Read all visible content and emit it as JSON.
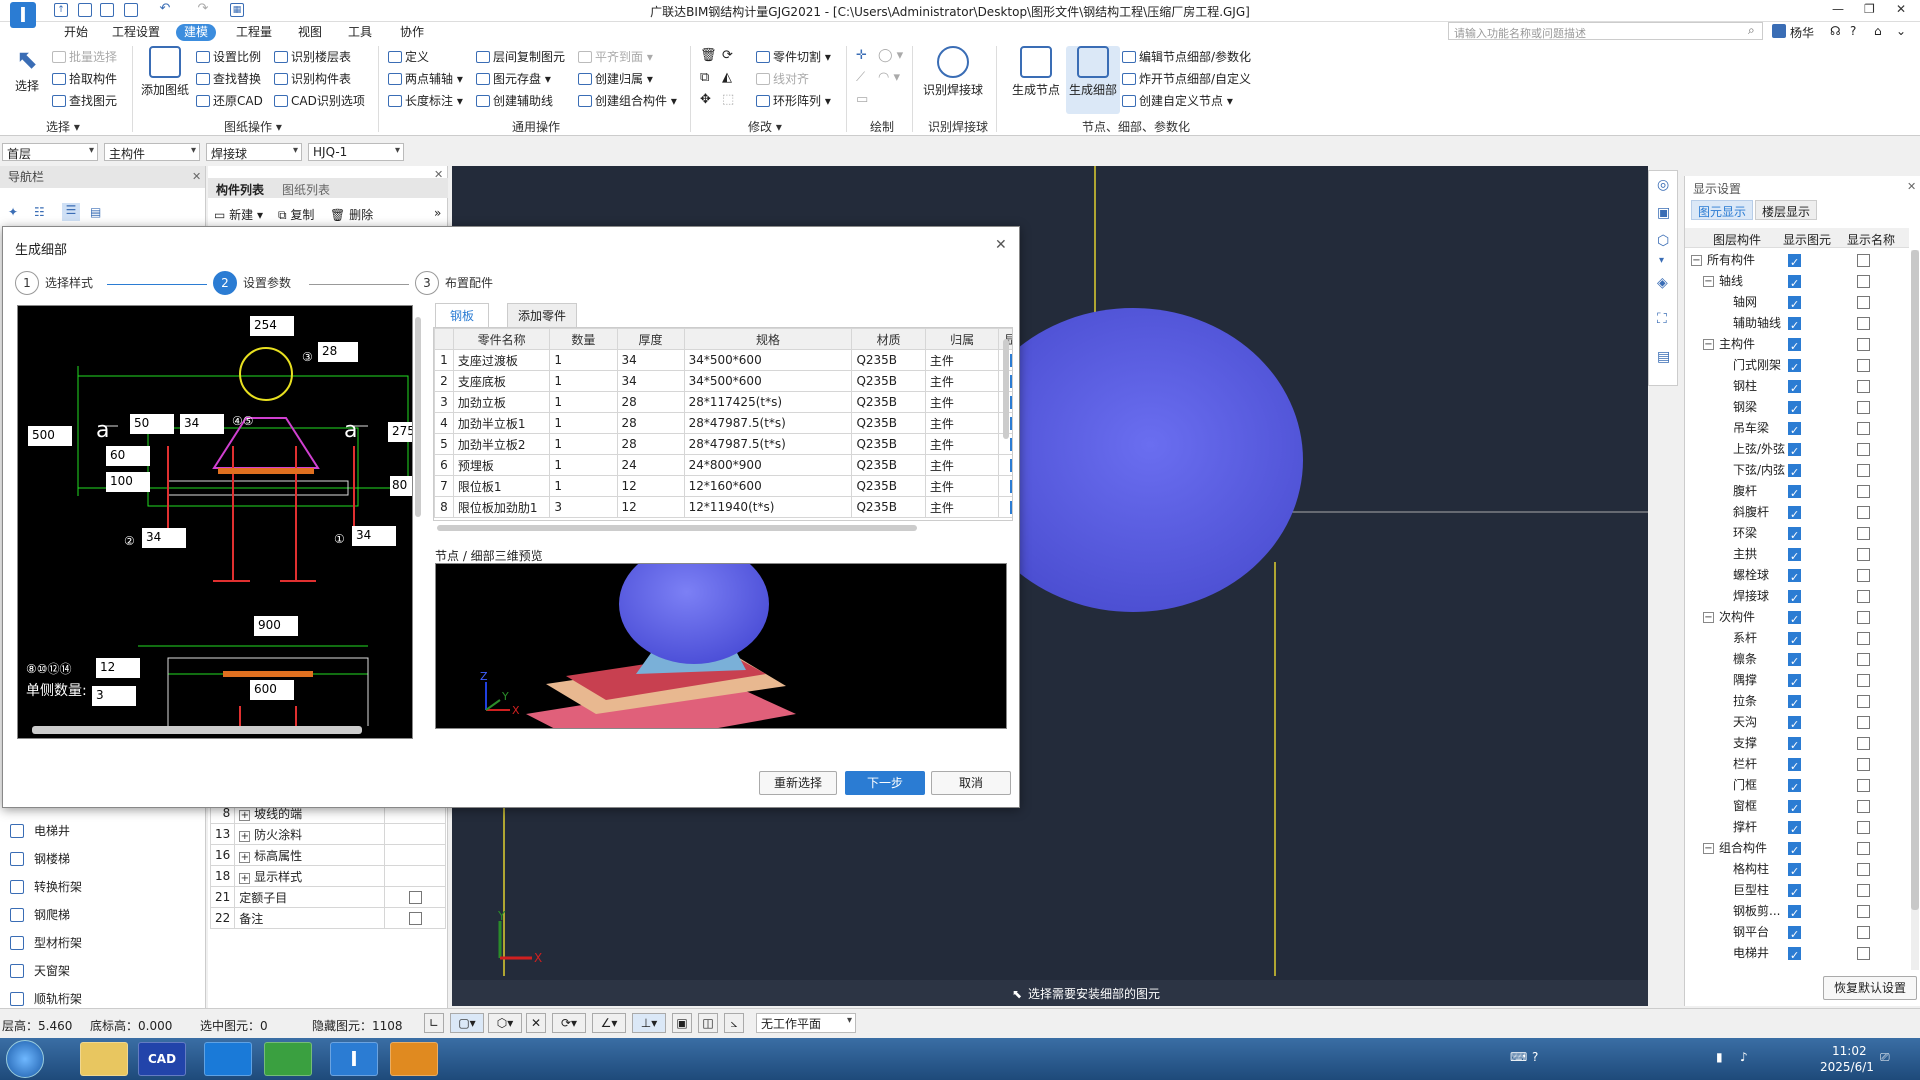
{
  "titlebar": {
    "title": "广联达BIM钢结构计量GJG2021 - [C:\\Users\\Administrator\\Desktop\\图形文件\\钢结构工程\\压缩厂房工程.GJG]",
    "search_placeholder": "请输入功能名称或问题描述",
    "user": "杨华",
    "help": "?"
  },
  "menu": [
    "开始",
    "工程设置",
    "建模",
    "工程量",
    "视图",
    "工具",
    "协作"
  ],
  "ribbon": {
    "select": {
      "label": "选择",
      "items": [
        "批量选择",
        "拾取构件",
        "查找图元"
      ],
      "group": "选择"
    },
    "drawing": {
      "add": "添加图纸",
      "items": [
        "设置比例",
        "查找替换",
        "还原CAD",
        "识别楼层表",
        "识别构件表",
        "CAD识别选项"
      ],
      "group": "图纸操作"
    },
    "general": {
      "items": [
        "定义",
        "两点辅轴",
        "长度标注",
        "层间复制图元",
        "图元存盘",
        "创建辅助线",
        "平齐到面",
        "创建归属",
        "创建组合构件"
      ],
      "group": "通用操作"
    },
    "modify": {
      "items": [
        "零件切割",
        "线对齐",
        "环形阵列"
      ],
      "group": "修改"
    },
    "draw": {
      "group": "绘制"
    },
    "weld": {
      "label": "识别焊接球",
      "group": "识别焊接球"
    },
    "node": {
      "gen_node": "生成节点",
      "gen_detail": "生成细部",
      "items": [
        "编辑节点细部/参数化",
        "炸开节点细部/自定义",
        "创建自定义节点"
      ],
      "group": "节点、细部、参数化"
    }
  },
  "filters": [
    "首层",
    "主构件",
    "焊接球",
    "HJQ-1"
  ],
  "nav": {
    "title": "导航栏",
    "items": [
      "电梯井",
      "钢楼梯",
      "转换桁架",
      "钢爬梯",
      "型材桁架",
      "天窗架",
      "顺轨桁架"
    ]
  },
  "components": {
    "tabs": [
      "构件列表",
      "图纸列表"
    ],
    "actions": [
      "新建",
      "复制",
      "删除"
    ],
    "props": [
      {
        "no": "8",
        "name": "坡线的端"
      },
      {
        "no": "13",
        "name": "防火涂料"
      },
      {
        "no": "16",
        "name": "标高属性"
      },
      {
        "no": "18",
        "name": "显示样式"
      },
      {
        "no": "21",
        "name": "定额子目"
      },
      {
        "no": "22",
        "name": "备注"
      }
    ]
  },
  "dialog": {
    "title": "生成细部",
    "steps": [
      {
        "no": "1",
        "label": "选择样式"
      },
      {
        "no": "2",
        "label": "设置参数"
      },
      {
        "no": "3",
        "label": "布置配件"
      }
    ],
    "cad_labels": {
      "d254": "254",
      "d28": "28",
      "d500": "500",
      "d50": "50",
      "d34a": "34",
      "d60": "60",
      "d100": "100",
      "d275": "275",
      "d80": "80",
      "d34b": "34",
      "d34c": "34",
      "d900": "900",
      "d12": "12",
      "d3": "3",
      "d600": "600",
      "a1": "a",
      "a2": "a",
      "c3": "③",
      "c45": "④⑤",
      "c2": "②",
      "c1": "①",
      "circles": "⑧⑩⑫⑭",
      "side_qty": "单侧数量:"
    },
    "tabs": [
      "钢板",
      "添加零件"
    ],
    "table": {
      "headers": [
        "",
        "零件名称",
        "数量",
        "厚度",
        "规格",
        "材质",
        "归属",
        "显示"
      ],
      "rows": [
        [
          "1",
          "支座过渡板",
          "1",
          "34",
          "34*500*600",
          "Q235B",
          "主件"
        ],
        [
          "2",
          "支座底板",
          "1",
          "34",
          "34*500*600",
          "Q235B",
          "主件"
        ],
        [
          "3",
          "加劲立板",
          "1",
          "28",
          "28*117425(t*s)",
          "Q235B",
          "主件"
        ],
        [
          "4",
          "加劲半立板1",
          "1",
          "28",
          "28*47987.5(t*s)",
          "Q235B",
          "主件"
        ],
        [
          "5",
          "加劲半立板2",
          "1",
          "28",
          "28*47987.5(t*s)",
          "Q235B",
          "主件"
        ],
        [
          "6",
          "预埋板",
          "1",
          "24",
          "24*800*900",
          "Q235B",
          "主件"
        ],
        [
          "7",
          "限位板1",
          "1",
          "12",
          "12*160*600",
          "Q235B",
          "主件"
        ],
        [
          "8",
          "限位板加劲肋1",
          "3",
          "12",
          "12*11940(t*s)",
          "Q235B",
          "主件"
        ]
      ]
    },
    "preview_label": "节点 / 细部三维预览",
    "buttons": {
      "reselect": "重新选择",
      "next": "下一步",
      "cancel": "取消"
    }
  },
  "viewport": {
    "hint": "选择需要安装细部的图元"
  },
  "display": {
    "title": "显示设置",
    "tabs": [
      "图元显示",
      "楼层显示"
    ],
    "headers": [
      "图层构件",
      "显示图元",
      "显示名称"
    ],
    "rows": [
      {
        "label": "所有构件",
        "level": 0,
        "tog": "−"
      },
      {
        "label": "轴线",
        "level": 1,
        "tog": "−"
      },
      {
        "label": "轴网",
        "level": 2
      },
      {
        "label": "辅助轴线",
        "level": 2
      },
      {
        "label": "主构件",
        "level": 1,
        "tog": "−"
      },
      {
        "label": "门式刚架",
        "level": 2
      },
      {
        "label": "钢柱",
        "level": 2
      },
      {
        "label": "钢梁",
        "level": 2
      },
      {
        "label": "吊车梁",
        "level": 2
      },
      {
        "label": "上弦/外弦",
        "level": 2
      },
      {
        "label": "下弦/内弦",
        "level": 2
      },
      {
        "label": "腹杆",
        "level": 2
      },
      {
        "label": "斜腹杆",
        "level": 2
      },
      {
        "label": "环梁",
        "level": 2
      },
      {
        "label": "主拱",
        "level": 2
      },
      {
        "label": "螺栓球",
        "level": 2
      },
      {
        "label": "焊接球",
        "level": 2
      },
      {
        "label": "次构件",
        "level": 1,
        "tog": "−"
      },
      {
        "label": "系杆",
        "level": 2
      },
      {
        "label": "檩条",
        "level": 2
      },
      {
        "label": "隅撑",
        "level": 2
      },
      {
        "label": "拉条",
        "level": 2
      },
      {
        "label": "天沟",
        "level": 2
      },
      {
        "label": "支撑",
        "level": 2
      },
      {
        "label": "栏杆",
        "level": 2
      },
      {
        "label": "门框",
        "level": 2
      },
      {
        "label": "窗框",
        "level": 2
      },
      {
        "label": "撑杆",
        "level": 2
      },
      {
        "label": "组合构件",
        "level": 1,
        "tog": "−"
      },
      {
        "label": "格构柱",
        "level": 2
      },
      {
        "label": "巨型柱",
        "level": 2
      },
      {
        "label": "钢板剪...",
        "level": 2
      },
      {
        "label": "钢平台",
        "level": 2
      },
      {
        "label": "电梯井",
        "level": 2
      }
    ],
    "reset": "恢复默认设置"
  },
  "status": {
    "floor_height": "层高：5.460",
    "base_elev": "底标高：0.000",
    "selected": "选中图元：0",
    "hidden": "隐藏图元：1108",
    "work_plane": "无工作平面"
  },
  "taskbar": {
    "time": "11:02",
    "date": "2025/6/1"
  },
  "colors": {
    "accent": "#2b7cd3",
    "viewport_bg": "#232b3a",
    "sphere": "#5b5fe0"
  }
}
